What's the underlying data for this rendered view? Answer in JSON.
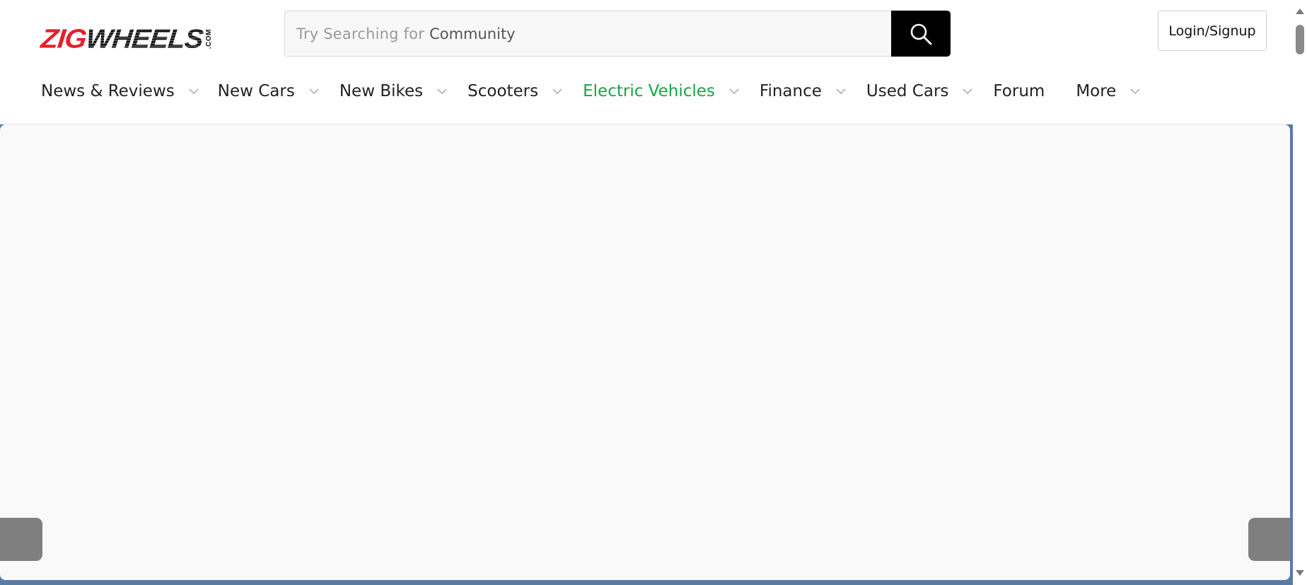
{
  "header": {
    "logo": {
      "part_a": "ZIG",
      "part_b": "WHEELS",
      "suffix": ".COM",
      "icon": "zigwheels-logo"
    },
    "search": {
      "prefix": "Try Searching for",
      "term": "Community",
      "button_icon": "search-icon"
    },
    "login_label": "Login/Signup"
  },
  "nav": {
    "items": [
      {
        "label": "News & Reviews",
        "has_dropdown": true,
        "active": false
      },
      {
        "label": "New Cars",
        "has_dropdown": true,
        "active": false
      },
      {
        "label": "New Bikes",
        "has_dropdown": true,
        "active": false
      },
      {
        "label": "Scooters",
        "has_dropdown": true,
        "active": false
      },
      {
        "label": "Electric Vehicles",
        "has_dropdown": true,
        "active": true
      },
      {
        "label": "Finance",
        "has_dropdown": true,
        "active": false
      },
      {
        "label": "Used Cars",
        "has_dropdown": true,
        "active": false
      },
      {
        "label": "Forum",
        "has_dropdown": false,
        "active": false
      },
      {
        "label": "More",
        "has_dropdown": true,
        "active": false
      }
    ]
  },
  "colors": {
    "brand_red": "#e4202a",
    "active_nav_green": "#17a446",
    "banner_border_blue": "#587ca3",
    "slider_arrow_gray": "#7f7f7f",
    "search_button_black": "#000000"
  },
  "banner": {
    "prev_arrow_icon": "slider-prev-arrow",
    "next_arrow_icon": "slider-next-arrow"
  },
  "scrollbar": {
    "up_icon": "scroll-up-arrow-icon",
    "down_icon": "scroll-down-arrow-icon"
  }
}
